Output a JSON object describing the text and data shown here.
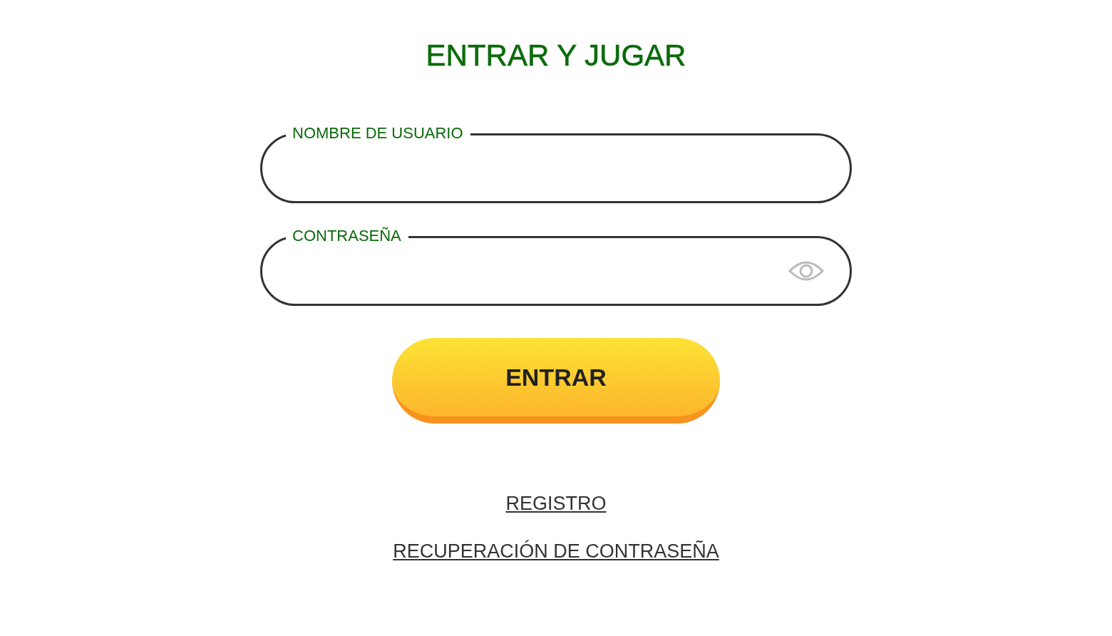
{
  "title": "ENTRAR Y JUGAR",
  "fields": [
    {
      "kind": "text",
      "label": "NOMBRE DE USUARIO"
    },
    {
      "kind": "password",
      "label": "CONTRASEÑA"
    }
  ],
  "submit": {
    "label": "ENTRAR"
  },
  "links": [
    {
      "label": "REGISTRO"
    },
    {
      "label": "RECUPERACIÓN DE CONTRASEÑA"
    }
  ]
}
